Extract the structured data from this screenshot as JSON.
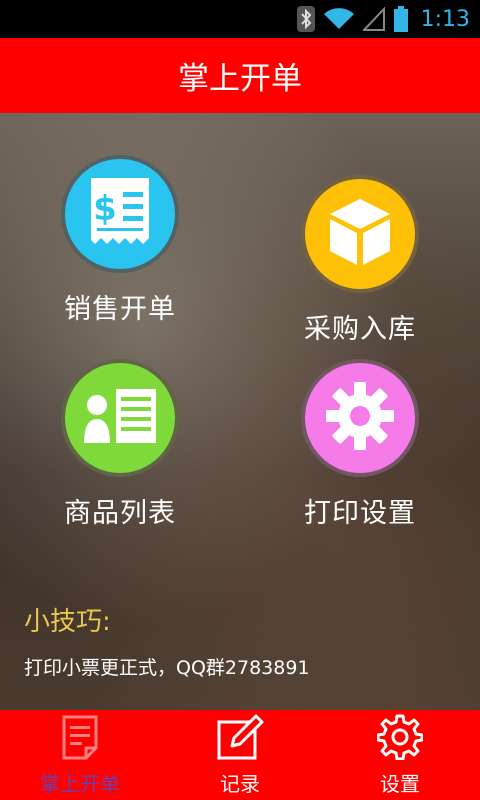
{
  "status_bar": {
    "time": "1:13",
    "icons": [
      "bluetooth-icon",
      "wifi-icon",
      "signal-icon",
      "battery-icon"
    ],
    "color": "#33b5e5"
  },
  "header": {
    "title": "掌上开单",
    "color": "#ff0000"
  },
  "menu": {
    "items": [
      {
        "label": "销售开单",
        "icon": "receipt-icon",
        "color": "#29c4f0"
      },
      {
        "label": "采购入库",
        "icon": "box-icon",
        "color": "#ffc107"
      },
      {
        "label": "商品列表",
        "icon": "contact-list-icon",
        "color": "#7fd93a"
      },
      {
        "label": "打印设置",
        "icon": "gear-icon",
        "color": "#f57ce8"
      }
    ]
  },
  "tips": {
    "title": "小技巧:",
    "text": "打印小票更正式，QQ群2783891"
  },
  "bottom_nav": {
    "tabs": [
      {
        "label": "掌上开单",
        "icon": "document-icon",
        "active": true
      },
      {
        "label": "记录",
        "icon": "edit-icon",
        "active": false
      },
      {
        "label": "设置",
        "icon": "gear-icon",
        "active": false
      }
    ]
  }
}
